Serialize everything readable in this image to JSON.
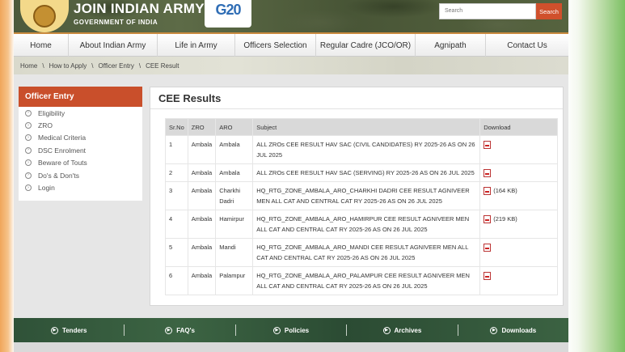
{
  "header": {
    "title": "JOIN INDIAN ARMY",
    "subtitle": "GOVERNMENT OF INDIA",
    "g20_logo": "G20",
    "search_placeholder": "Search",
    "search_button": "Search"
  },
  "nav": {
    "items": [
      "Home",
      "About Indian Army",
      "Life in Army",
      "Officers Selection",
      "Regular Cadre (JCO/OR)",
      "Agnipath",
      "Contact Us"
    ]
  },
  "breadcrumb": {
    "items": [
      "Home",
      "How to Apply",
      "Officer Entry",
      "CEE Result"
    ],
    "separator": "\\"
  },
  "sidebar": {
    "title": "Officer Entry",
    "items": [
      "Eligibility",
      "ZRO",
      "Medical Criteria",
      "DSC Enrolment",
      "Beware of Touts",
      "Do's & Don'ts",
      "Login"
    ]
  },
  "main": {
    "title": "CEE Results",
    "columns": [
      "Sr.No",
      "ZRO",
      "ARO",
      "Subject",
      "Download"
    ],
    "rows": [
      {
        "sr": "1",
        "zro": "Ambala",
        "aro": "Ambala",
        "subject": "ALL ZROs CEE RESULT HAV SAC (CIVIL CANDIDATES) RY 2025-26 AS ON 26 JUL 2025",
        "size": ""
      },
      {
        "sr": "2",
        "zro": "Ambala",
        "aro": "Ambala",
        "subject": "ALL ZROs CEE RESULT HAV SAC (SERVING) RY 2025-26 AS ON 26 JUL 2025",
        "size": ""
      },
      {
        "sr": "3",
        "zro": "Ambala",
        "aro": "Charkhi Dadri",
        "subject": "HQ_RTG_ZONE_AMBALA_ARO_CHARKHI DADRI CEE RESULT AGNIVEER MEN ALL CAT AND CENTRAL CAT RY 2025-26 AS ON 26 JUL 2025",
        "size": "(164 KB)"
      },
      {
        "sr": "4",
        "zro": "Ambala",
        "aro": "Hamirpur",
        "subject": "HQ_RTG_ZONE_AMBALA_ARO_HAMIRPUR CEE RESULT AGNIVEER MEN ALL CAT AND CENTRAL CAT RY 2025-26 AS ON 26 JUL 2025",
        "size": "(219 KB)"
      },
      {
        "sr": "5",
        "zro": "Ambala",
        "aro": "Mandi",
        "subject": "HQ_RTG_ZONE_AMBALA_ARO_MANDI CEE RESULT AGNIVEER MEN ALL CAT AND CENTRAL CAT RY 2025-26 AS ON 26 JUL 2025",
        "size": ""
      },
      {
        "sr": "6",
        "zro": "Ambala",
        "aro": "Palampur",
        "subject": "HQ_RTG_ZONE_AMBALA_ARO_PALAMPUR CEE RESULT AGNIVEER MEN ALL CAT AND CENTRAL CAT RY 2025-26 AS ON 26 JUL 2025",
        "size": ""
      }
    ]
  },
  "footer": {
    "items": [
      "Tenders",
      "FAQ's",
      "Policies",
      "Archives",
      "Downloads"
    ]
  },
  "colors": {
    "accent": "#c94f2b",
    "footer": "#2f5238",
    "header": "#4d5a3c"
  }
}
